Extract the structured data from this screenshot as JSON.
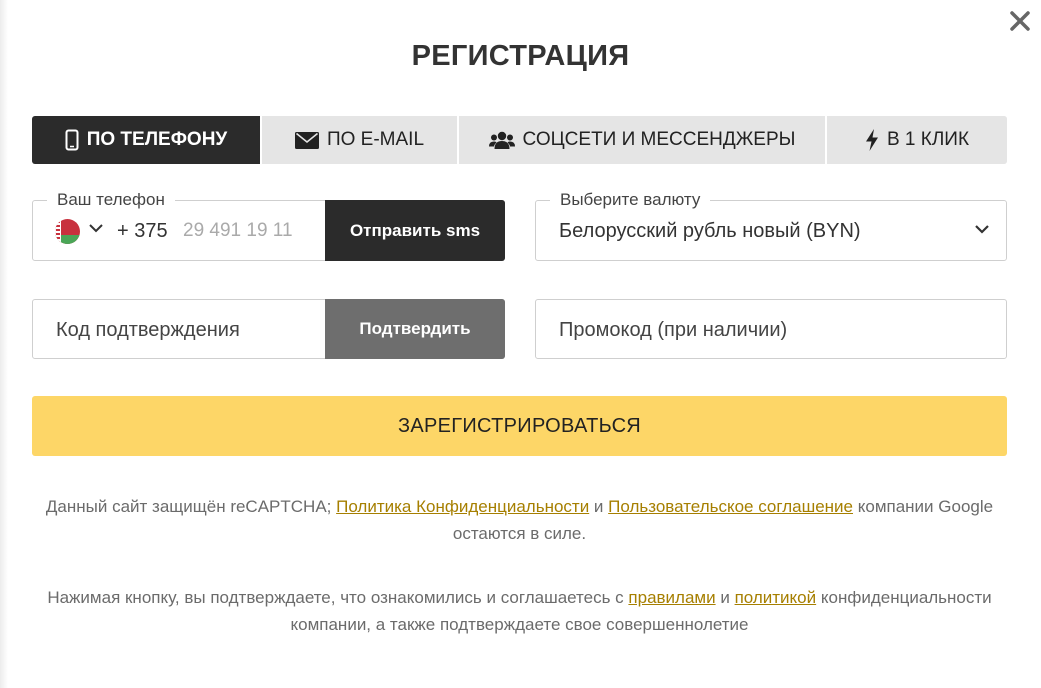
{
  "dialog": {
    "title": "РЕГИСТРАЦИЯ",
    "close_icon": "close-icon"
  },
  "tabs": [
    {
      "label": "ПО ТЕЛЕФОНУ",
      "icon": "phone-icon",
      "active": true
    },
    {
      "label": "ПО E-MAIL",
      "icon": "envelope-icon",
      "active": false
    },
    {
      "label": "СОЦСЕТИ И МЕССЕНДЖЕРЫ",
      "icon": "users-icon",
      "active": false
    },
    {
      "label": "В 1 КЛИК",
      "icon": "bolt-icon",
      "active": false
    }
  ],
  "phone": {
    "legend": "Ваш телефон",
    "country_flag": "belarus-flag-icon",
    "dial_code": "+ 375",
    "placeholder": "29 491 19 11",
    "value": "",
    "send_sms_label": "Отправить sms"
  },
  "currency": {
    "legend": "Выберите валюту",
    "selected": "Белорусский рубль новый (BYN)"
  },
  "confirmation": {
    "placeholder": "Код подтверждения",
    "confirm_label": "Подтвердить"
  },
  "promo": {
    "placeholder": "Промокод (при наличии)"
  },
  "register_label": "ЗАРЕГИСТРИРОВАТЬСЯ",
  "recaptcha_notice": {
    "prefix": "Данный сайт защищён reCAPTCHA; ",
    "privacy_link": "Политика Конфиденциальности",
    "and": " и ",
    "terms_link": "Пользовательское соглашение",
    "suffix": " компании Google остаются в силе."
  },
  "consent_notice": {
    "prefix": "Нажимая кнопку, вы подтверждаете, что ознакомились и соглашаетесь с ",
    "rules_link": "правилами",
    "and": " и ",
    "policy_link": "политикой",
    "suffix": " конфиденциальности компании, а также подтверждаете свое совершеннолетие"
  },
  "colors": {
    "accent_yellow": "#fdd667",
    "dark": "#2b2b2b",
    "link": "#a67f00"
  }
}
